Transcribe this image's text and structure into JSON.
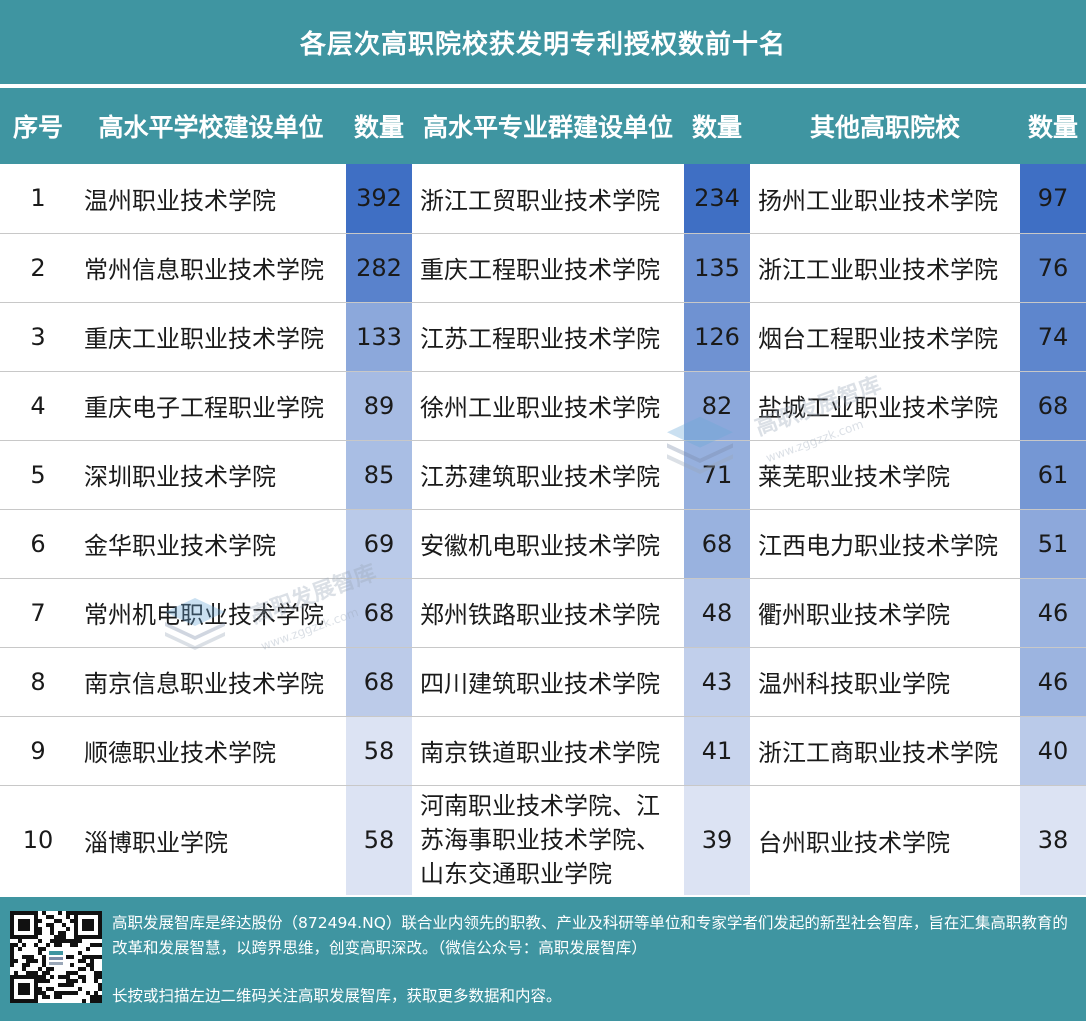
{
  "title": "各层次高职院校获发明专利授权数前十名",
  "headers": {
    "idx": "序号",
    "g1_name": "高水平学校建设单位",
    "g1_num": "数量",
    "g2_name": "高水平专业群建设单位",
    "g2_num": "数量",
    "g3_name": "其他高职院校",
    "g3_num": "数量"
  },
  "rows": [
    {
      "idx": "1",
      "g1_name": "温州职业技术学院",
      "g1_num": "392",
      "g2_name": "浙江工贸职业技术学院",
      "g2_num": "234",
      "g3_name": "扬州工业职业技术学院",
      "g3_num": "97"
    },
    {
      "idx": "2",
      "g1_name": "常州信息职业技术学院",
      "g1_num": "282",
      "g2_name": "重庆工程职业技术学院",
      "g2_num": "135",
      "g3_name": "浙江工业职业技术学院",
      "g3_num": "76"
    },
    {
      "idx": "3",
      "g1_name": "重庆工业职业技术学院",
      "g1_num": "133",
      "g2_name": "江苏工程职业技术学院",
      "g2_num": "126",
      "g3_name": "烟台工程职业技术学院",
      "g3_num": "74"
    },
    {
      "idx": "4",
      "g1_name": "重庆电子工程职业学院",
      "g1_num": "89",
      "g2_name": "徐州工业职业技术学院",
      "g2_num": "82",
      "g3_name": "盐城工业职业技术学院",
      "g3_num": "68"
    },
    {
      "idx": "5",
      "g1_name": "深圳职业技术学院",
      "g1_num": "85",
      "g2_name": "江苏建筑职业技术学院",
      "g2_num": "71",
      "g3_name": "莱芜职业技术学院",
      "g3_num": "61"
    },
    {
      "idx": "6",
      "g1_name": "金华职业技术学院",
      "g1_num": "69",
      "g2_name": "安徽机电职业技术学院",
      "g2_num": "68",
      "g3_name": "江西电力职业技术学院",
      "g3_num": "51"
    },
    {
      "idx": "7",
      "g1_name": "常州机电职业技术学院",
      "g1_num": "68",
      "g2_name": "郑州铁路职业技术学院",
      "g2_num": "48",
      "g3_name": "衢州职业技术学院",
      "g3_num": "46"
    },
    {
      "idx": "8",
      "g1_name": "南京信息职业技术学院",
      "g1_num": "68",
      "g2_name": "四川建筑职业技术学院",
      "g2_num": "43",
      "g3_name": "温州科技职业学院",
      "g3_num": "46"
    },
    {
      "idx": "9",
      "g1_name": "顺德职业技术学院",
      "g1_num": "58",
      "g2_name": "南京铁道职业技术学院",
      "g2_num": "41",
      "g3_name": "浙江工商职业技术学院",
      "g3_num": "40"
    },
    {
      "idx": "10",
      "g1_name": "淄博职业学院",
      "g1_num": "58",
      "g2_name": "河南职业技术学院、江苏海事职业技术学院、山东交通职业学院",
      "g2_num": "39",
      "g3_name": "台州职业技术学院",
      "g3_num": "38"
    }
  ],
  "row10_g2_lines": [
    "河南职业技术学院、江",
    "苏海事职业技术学院、",
    "山东交通职业学院"
  ],
  "footer": {
    "line1": "高职发展智库是绎达股份（872494.NQ）联合业内领先的职教、产业及科研等单位和专家学者们发起的新型社会智库，旨在汇集高职教育的改革和发展智慧，以跨界思维，创变高职深改。（微信公众号：高职发展智库）",
    "line2": "长按或扫描左边二维码关注高职发展智库，获取更多数据和内容。"
  },
  "watermark": {
    "text": "高职发展智库",
    "url": "www.zggzzk.com"
  },
  "colors": {
    "header_bg": "#3f95a1",
    "heat_max": "#3f6fc4",
    "heat_min": "#dce3f3"
  }
}
